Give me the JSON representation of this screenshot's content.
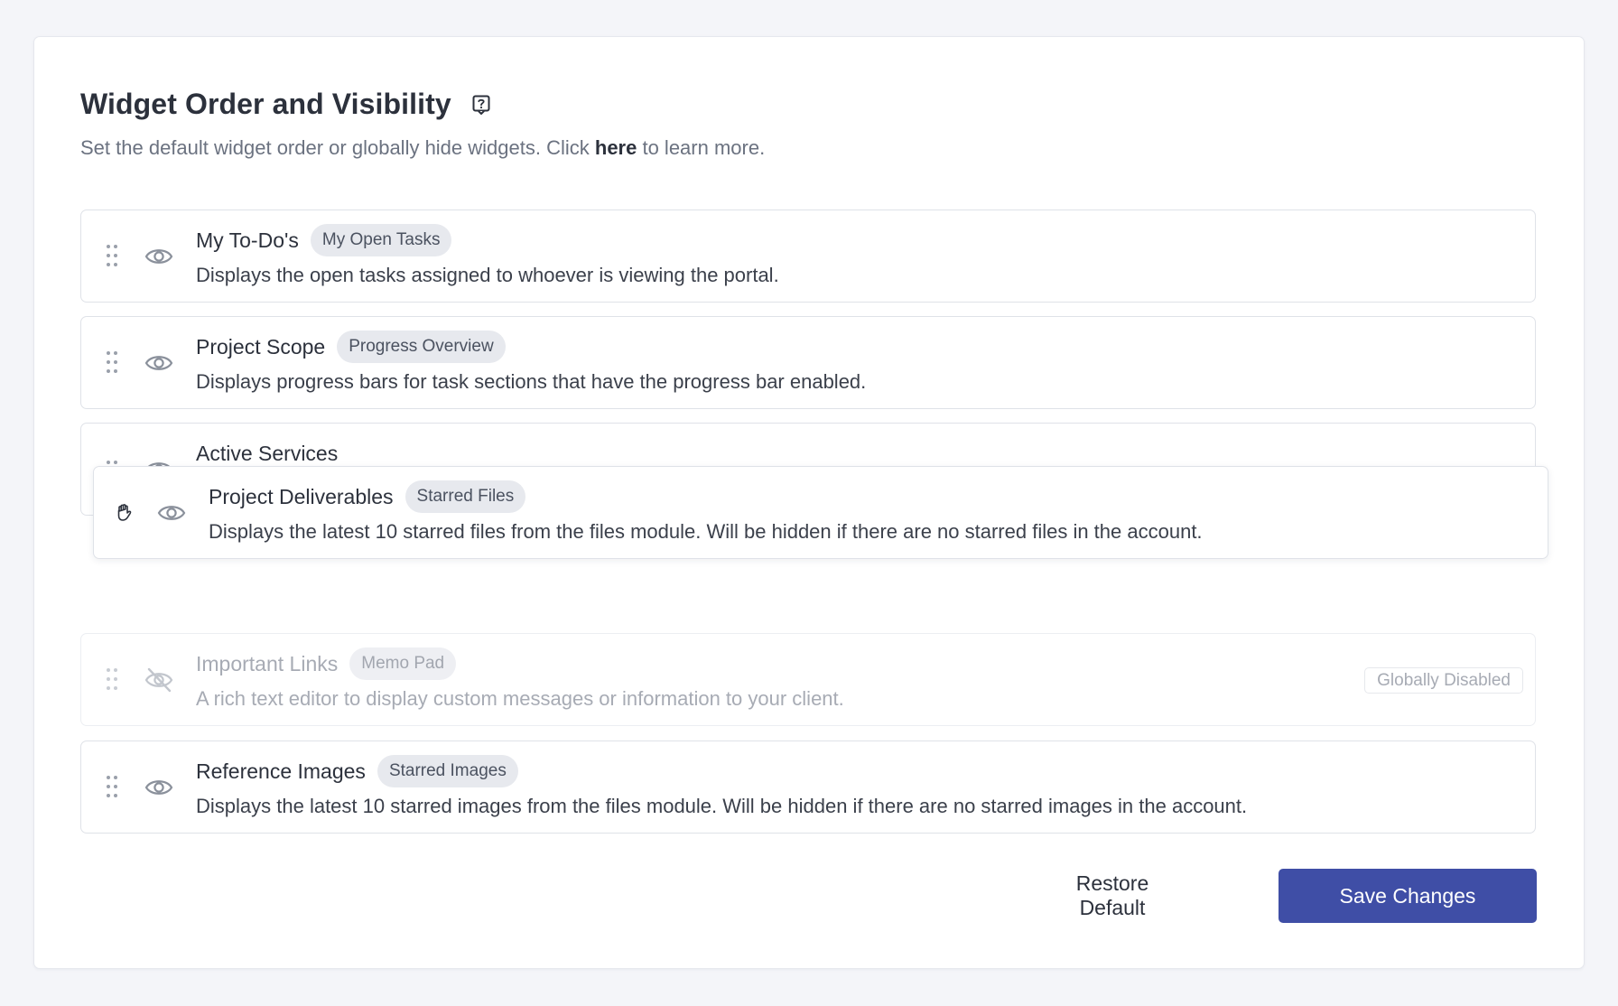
{
  "header": {
    "title": "Widget Order and Visibility",
    "subtitle_prefix": "Set the default widget order or globally hide widgets. Click ",
    "subtitle_link": "here",
    "subtitle_suffix": " to learn more."
  },
  "widgets": [
    {
      "name": "My To-Do's",
      "tag": "My Open Tasks",
      "description": "Displays the open tasks assigned to whoever is viewing the portal.",
      "visible": true
    },
    {
      "name": "Project Scope",
      "tag": "Progress Overview",
      "description": "Displays progress bars for task sections that have the progress bar enabled.",
      "visible": true
    },
    {
      "name": "Active Services",
      "tag": "",
      "description": "",
      "visible": true
    },
    {
      "name": "Project Deliverables",
      "tag": "Starred Files",
      "description": "Displays the latest 10 starred files from the files module. Will be hidden if there are no starred files in the account.",
      "visible": true,
      "state": "dragging"
    },
    {
      "name": "Important Links",
      "tag": "Memo Pad",
      "description": "A rich text editor to display custom messages or information to your client.",
      "visible": false,
      "badge": "Globally Disabled"
    },
    {
      "name": "Reference Images",
      "tag": "Starred Images",
      "description": "Displays the latest 10 starred images from the files module. Will be hidden if there are no starred images in the account.",
      "visible": true
    }
  ],
  "actions": {
    "restore_label": "Restore Default",
    "save_label": "Save Changes"
  },
  "colors": {
    "primary": "#3f4ea6",
    "tag_bg": "#e7e9ee",
    "border": "#dfe2e8"
  },
  "icons": {
    "help": "help-question-icon",
    "drag": "drag-handle-icon",
    "eye": "eye-icon",
    "eye_off": "eye-off-icon",
    "grab": "grab-hand-icon"
  }
}
